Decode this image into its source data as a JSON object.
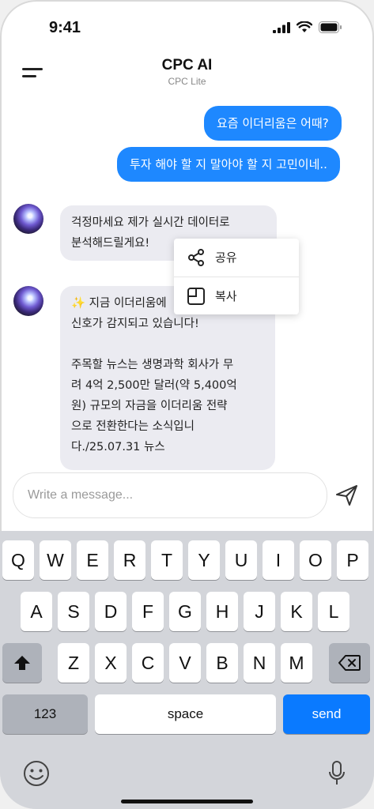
{
  "status_bar": {
    "time": "9:41"
  },
  "header": {
    "title": "CPC AI",
    "subtitle": "CPC Lite"
  },
  "messages": {
    "user": [
      "요즘 이더리움은 어때?",
      "투자 해야 할 지 말아야 할 지 고민이네.."
    ],
    "ai": [
      "걱정마세요 제가 실시간 데이터로\n분석해드릴게요!",
      "✨ 지금 이더리움에\n신호가 감지되고 있습니다!\n\n주목할 뉴스는 생명과학 회사가 무\n려 4억 2,500만 달러(약 5,400억\n원) 규모의 자금을 이더리움 전략\n으로 전환한다는 소식입니\n다./25.07.31 뉴스"
    ]
  },
  "context_menu": {
    "share_label": "공유",
    "copy_label": "복사"
  },
  "composer": {
    "placeholder": "Write a message..."
  },
  "keyboard": {
    "row1": [
      "Q",
      "W",
      "E",
      "R",
      "T",
      "Y",
      "U",
      "I",
      "O",
      "P"
    ],
    "row2": [
      "A",
      "S",
      "D",
      "F",
      "G",
      "H",
      "J",
      "K",
      "L"
    ],
    "row3": [
      "Z",
      "X",
      "C",
      "V",
      "B",
      "N",
      "M"
    ],
    "numbers_label": "123",
    "space_label": "space",
    "send_label": "send"
  },
  "colors": {
    "accent": "#1e88ff",
    "keyboard_bg": "#d3d5da",
    "ai_bubble": "#ebebf1"
  }
}
